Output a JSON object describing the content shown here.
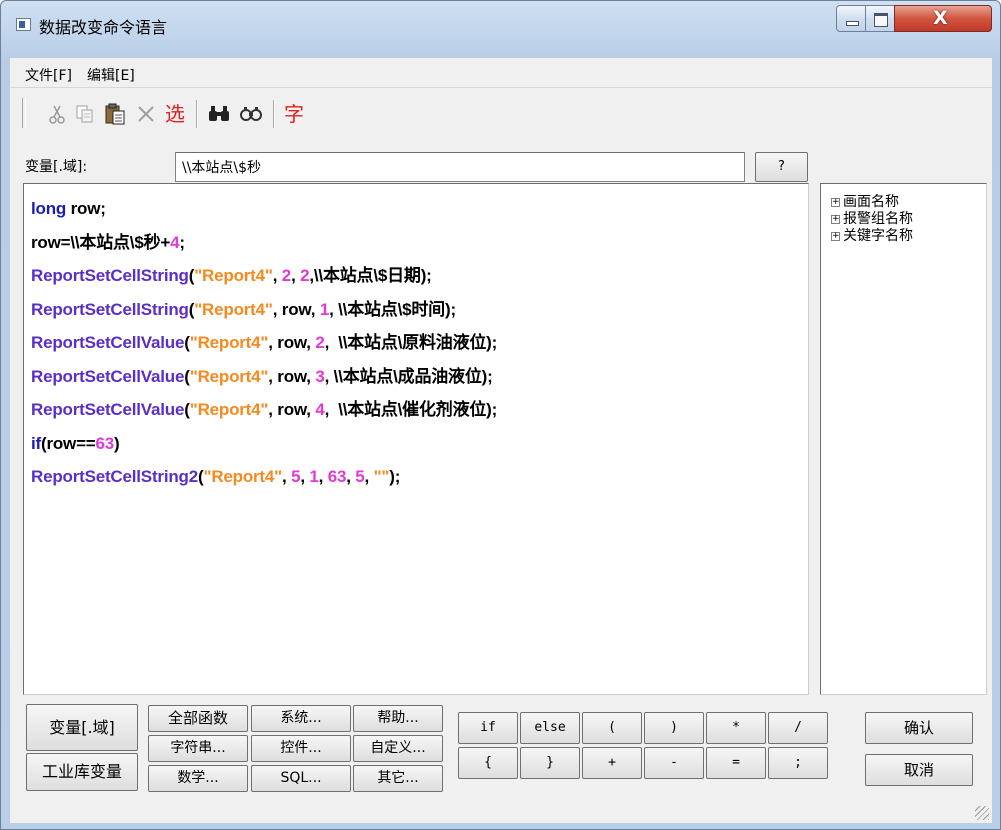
{
  "window": {
    "title": "数据改变命令语言"
  },
  "menu": [
    "文件[F]",
    "编辑[E]"
  ],
  "toolbar": {
    "icons": [
      "cut-icon",
      "copy-icon",
      "paste-icon",
      "delete-icon",
      "select-icon",
      "find-icon",
      "replace-icon",
      "font-icon"
    ],
    "select_label": "选",
    "font_label": "字"
  },
  "variable": {
    "label": "变量[.域]:",
    "value": "\\\\本站点\\$秒",
    "browse_label": "?"
  },
  "code_lines": [
    [
      [
        "kw",
        "long"
      ],
      [
        "pl",
        " row;"
      ]
    ],
    [
      [
        "pl",
        "row=\\\\本站点\\$秒+"
      ],
      [
        "num",
        "4"
      ],
      [
        "pl",
        ";"
      ]
    ],
    [
      [
        "fn",
        "ReportSetCellString"
      ],
      [
        "pl",
        "("
      ],
      [
        "str",
        "\"Report4\""
      ],
      [
        "pl",
        ", "
      ],
      [
        "num",
        "2"
      ],
      [
        "pl",
        ", "
      ],
      [
        "num",
        "2"
      ],
      [
        "pl",
        ",\\\\本站点\\$日期);"
      ]
    ],
    [
      [
        "fn",
        "ReportSetCellString"
      ],
      [
        "pl",
        "("
      ],
      [
        "str",
        "\"Report4\""
      ],
      [
        "pl",
        ", row, "
      ],
      [
        "num",
        "1"
      ],
      [
        "pl",
        ", \\\\本站点\\$时间);"
      ]
    ],
    [
      [
        "fn",
        "ReportSetCellValue"
      ],
      [
        "pl",
        "("
      ],
      [
        "str",
        "\"Report4\""
      ],
      [
        "pl",
        ", row, "
      ],
      [
        "num",
        "2"
      ],
      [
        "pl",
        ",  \\\\本站点\\原料油液位);"
      ]
    ],
    [
      [
        "fn",
        "ReportSetCellValue"
      ],
      [
        "pl",
        "("
      ],
      [
        "str",
        "\"Report4\""
      ],
      [
        "pl",
        ", row, "
      ],
      [
        "num",
        "3"
      ],
      [
        "pl",
        ", \\\\本站点\\成品油液位);"
      ]
    ],
    [
      [
        "fn",
        "ReportSetCellValue"
      ],
      [
        "pl",
        "("
      ],
      [
        "str",
        "\"Report4\""
      ],
      [
        "pl",
        ", row, "
      ],
      [
        "num",
        "4"
      ],
      [
        "pl",
        ",  \\\\本站点\\催化剂液位);"
      ]
    ],
    [
      [
        "kw",
        "if"
      ],
      [
        "pl",
        "(row=="
      ],
      [
        "num",
        "63"
      ],
      [
        "pl",
        ")"
      ]
    ],
    [
      [
        "fn",
        "ReportSetCellString2"
      ],
      [
        "pl",
        "("
      ],
      [
        "str",
        "\"Report4\""
      ],
      [
        "pl",
        ", "
      ],
      [
        "num",
        "5"
      ],
      [
        "pl",
        ", "
      ],
      [
        "num",
        "1"
      ],
      [
        "pl",
        ", "
      ],
      [
        "num",
        "63"
      ],
      [
        "pl",
        ", "
      ],
      [
        "num",
        "5"
      ],
      [
        "pl",
        ", "
      ],
      [
        "str",
        "\"\""
      ],
      [
        "pl",
        ");"
      ]
    ]
  ],
  "tree": [
    "画面名称",
    "报警组名称",
    "关键字名称"
  ],
  "tree_expander": "+",
  "buttons": {
    "var_field": "变量[.域]",
    "industrial_db": "工业库变量",
    "all_functions": "全部函数",
    "system": "系统...",
    "help": "帮助...",
    "string": "字符串...",
    "control": "控件...",
    "custom": "自定义...",
    "math": "数学...",
    "sql": "SQL...",
    "other": "其它..."
  },
  "symbols": {
    "if": "if",
    "else": "else",
    "lparen": "(",
    "rparen": ")",
    "mul": "*",
    "div": "/",
    "lbrace": "{",
    "rbrace": "}",
    "plus": "+",
    "minus": "-",
    "eq": "=",
    "semi": ";"
  },
  "actions": {
    "ok": "确认",
    "cancel": "取消"
  }
}
